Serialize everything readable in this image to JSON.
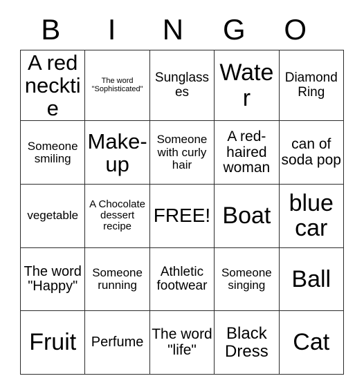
{
  "card": {
    "title_letters": [
      "B",
      "I",
      "N",
      "G",
      "O"
    ],
    "free_space_label": "FREE!",
    "border_color": "#2b2b2b",
    "background_color": "#ffffff",
    "text_color": "#000000",
    "columns": 5,
    "rows": 5,
    "cells": [
      [
        {
          "text": "A red necktie",
          "size": "h2"
        },
        {
          "text": "The word \"Sophisticated\"",
          "size": "xs"
        },
        {
          "text": "Sunglasses",
          "size": "ml"
        },
        {
          "text": "Water",
          "size": "h3"
        },
        {
          "text": "Diamond Ring",
          "size": "ml"
        }
      ],
      [
        {
          "text": "Someone smiling",
          "size": "m"
        },
        {
          "text": "Make-up",
          "size": "h2"
        },
        {
          "text": "Someone with curly hair",
          "size": "m"
        },
        {
          "text": "A red-haired woman",
          "size": "xl"
        },
        {
          "text": "can of soda pop",
          "size": "xl"
        }
      ],
      [
        {
          "text": "vegetable",
          "size": "m"
        },
        {
          "text": "A Chocolate dessert recipe",
          "size": "s"
        },
        {
          "text": "FREE!",
          "size": "h1"
        },
        {
          "text": "Boat",
          "size": "h3"
        },
        {
          "text": "blue car",
          "size": "h3"
        }
      ],
      [
        {
          "text": "The word \"Happy\"",
          "size": "l"
        },
        {
          "text": "Someone running",
          "size": "m"
        },
        {
          "text": "Athletic footwear",
          "size": "ml"
        },
        {
          "text": "Someone singing",
          "size": "m"
        },
        {
          "text": "Ball",
          "size": "h3"
        }
      ],
      [
        {
          "text": "Fruit",
          "size": "h3"
        },
        {
          "text": "Perfume",
          "size": "l"
        },
        {
          "text": "The word \"life\"",
          "size": "xl"
        },
        {
          "text": "Black Dress",
          "size": "xxl"
        },
        {
          "text": "Cat",
          "size": "h3"
        }
      ]
    ]
  }
}
